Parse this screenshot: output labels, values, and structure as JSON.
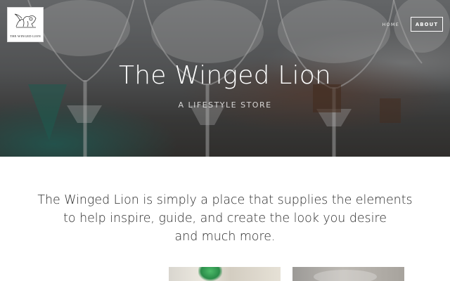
{
  "brand": {
    "logo_text": "THE WINGED LION"
  },
  "nav": {
    "items": [
      {
        "label": "HOME",
        "active": false
      },
      {
        "label": "ABOUT",
        "active": true
      }
    ]
  },
  "hero": {
    "title": "The Winged Lion",
    "subtitle": "A Lifestyle Store",
    "overlay_color": "#141414"
  },
  "intro": {
    "lines": [
      "The Winged Lion is simply a place that supplies the elements",
      "to help inspire, guide, and create the look you desire",
      "and much more."
    ]
  },
  "gallery": {
    "accent_color": "#2a8c49"
  },
  "colors": {
    "text": "#2b2b2b",
    "hero_text": "#ffffff",
    "background": "#ffffff"
  }
}
